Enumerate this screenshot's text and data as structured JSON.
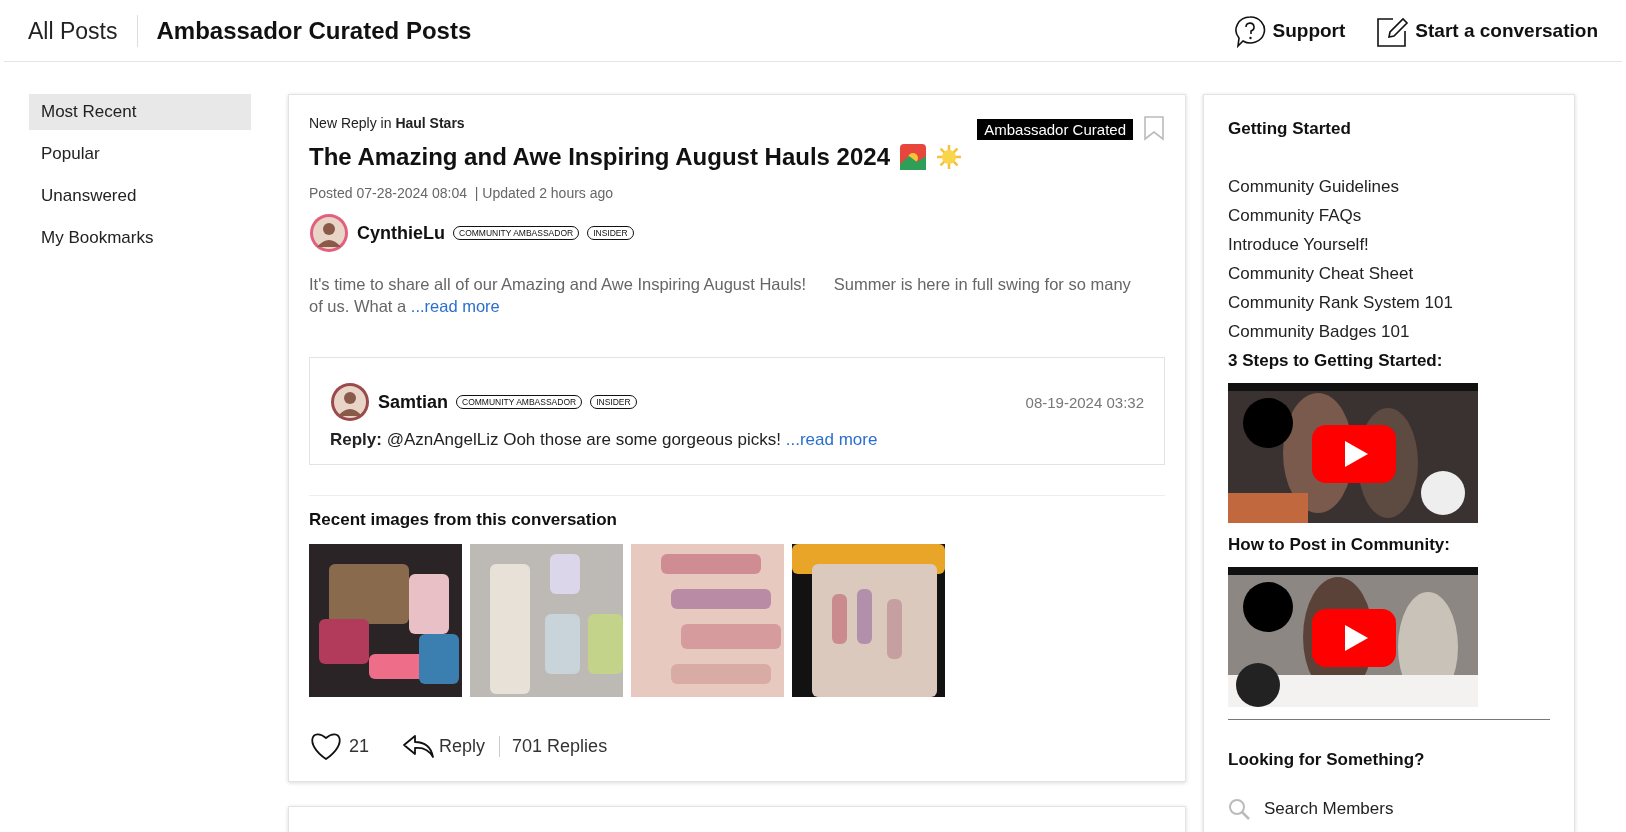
{
  "header": {
    "back_link": "All Posts",
    "title": "Ambassador Curated Posts",
    "actions": [
      {
        "kind": "support",
        "label": "Support"
      },
      {
        "kind": "compose",
        "label": "Start a conversation"
      }
    ]
  },
  "nav": [
    {
      "label": "Most Recent",
      "selected": true
    },
    {
      "label": "Popular",
      "selected": false
    },
    {
      "label": "Unanswered",
      "selected": false
    },
    {
      "label": "My Bookmarks",
      "selected": false
    }
  ],
  "post": {
    "context": "New Reply in **Haul Stars**",
    "tag": "Ambassador Curated",
    "bookmarked": false,
    "title": "The Amazing and Awe Inspiring August Hauls 2024",
    "posted": "Posted 07-28-2024 08:04",
    "updated": "| Updated 2 hours ago",
    "author": {
      "name": "CynthieLu",
      "badges": [
        "COMMUNITY AMBASSADOR",
        "INSIDER"
      ]
    },
    "excerpt": "It's time to share all of our Amazing and Awe Inspiring August Hauls!      Summer is here in full swing for so many of us. What a",
    "read_more": "...read more",
    "reply": {
      "author": "Samtian",
      "badges": [
        "COMMUNITY AMBASSADOR",
        "INSIDER"
      ],
      "date": "08-19-2024 03:32",
      "text": "**Reply:** @AznAngelLiz Ooh those are some gorgeous picks!",
      "read_more": "...read more"
    },
    "images_heading": "Recent images from this conversation",
    "likes": "21",
    "reply_label": "Reply",
    "replies": "701 Replies"
  },
  "sidebar": {
    "heading": "Getting Started",
    "links": [
      "Community Guidelines",
      "Community FAQs",
      "Introduce Yourself!",
      "Community Cheat Sheet",
      "Community Rank System 101",
      "Community Badges 101"
    ],
    "videos": [
      {
        "heading": "3 Steps to Getting Started:",
        "kind": "picture"
      },
      {
        "heading": "How to Post in Community:",
        "kind": "picture"
      }
    ],
    "search_heading": "Looking for Something?",
    "search": {
      "placeholder": "Search Members"
    }
  }
}
